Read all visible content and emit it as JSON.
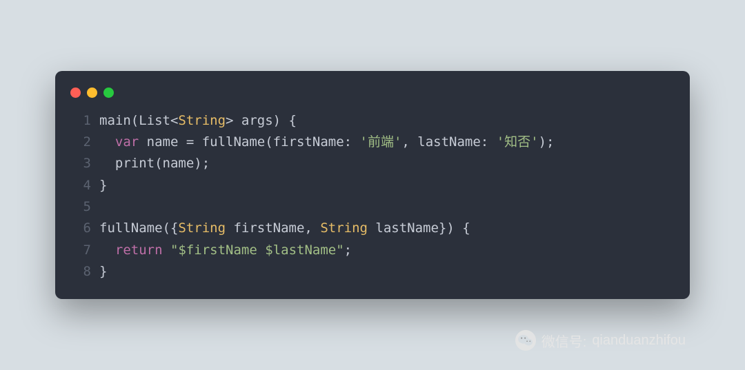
{
  "window": {
    "buttons": {
      "close_color": "#ff5f56",
      "minimize_color": "#ffbd2e",
      "maximize_color": "#27c93f"
    }
  },
  "code": {
    "lines": [
      {
        "n": "1",
        "tokens": [
          {
            "t": "text",
            "v": "main(List<"
          },
          {
            "t": "type",
            "v": "String"
          },
          {
            "t": "text",
            "v": "> args) {"
          }
        ]
      },
      {
        "n": "2",
        "tokens": [
          {
            "t": "text",
            "v": "  "
          },
          {
            "t": "keyword",
            "v": "var"
          },
          {
            "t": "text",
            "v": " name = fullName(firstName: "
          },
          {
            "t": "string",
            "v": "'前端'"
          },
          {
            "t": "text",
            "v": ", lastName: "
          },
          {
            "t": "string",
            "v": "'知否'"
          },
          {
            "t": "text",
            "v": ");"
          }
        ]
      },
      {
        "n": "3",
        "tokens": [
          {
            "t": "text",
            "v": "  print(name);"
          }
        ]
      },
      {
        "n": "4",
        "tokens": [
          {
            "t": "text",
            "v": "}"
          }
        ]
      },
      {
        "n": "5",
        "tokens": [
          {
            "t": "text",
            "v": ""
          }
        ]
      },
      {
        "n": "6",
        "tokens": [
          {
            "t": "text",
            "v": "fullName({"
          },
          {
            "t": "type",
            "v": "String"
          },
          {
            "t": "text",
            "v": " firstName, "
          },
          {
            "t": "type",
            "v": "String"
          },
          {
            "t": "text",
            "v": " lastName}) {"
          }
        ]
      },
      {
        "n": "7",
        "tokens": [
          {
            "t": "text",
            "v": "  "
          },
          {
            "t": "keyword",
            "v": "return"
          },
          {
            "t": "text",
            "v": " "
          },
          {
            "t": "string",
            "v": "\"$firstName $lastName\""
          },
          {
            "t": "text",
            "v": ";"
          }
        ]
      },
      {
        "n": "8",
        "tokens": [
          {
            "t": "text",
            "v": "}"
          }
        ]
      }
    ]
  },
  "watermark": {
    "label": "微信号:",
    "value": "qianduanzhifou"
  }
}
